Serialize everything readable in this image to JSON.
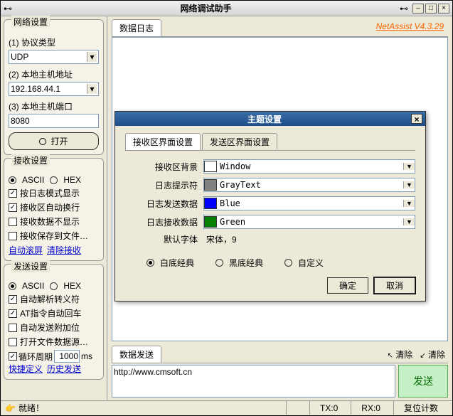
{
  "window": {
    "title": "网络调试助手"
  },
  "version": "NetAssist V4.3.29",
  "network": {
    "legend": "网络设置",
    "protocol_label": "(1) 协议类型",
    "protocol_value": "UDP",
    "host_label": "(2) 本地主机地址",
    "host_value": "192.168.44.1",
    "port_label": "(3) 本地主机端口",
    "port_value": "8080",
    "open_btn": "打开"
  },
  "recv": {
    "legend": "接收设置",
    "ascii": "ASCII",
    "hex": "HEX",
    "opt1": "按日志模式显示",
    "opt2": "接收区自动换行",
    "opt3": "接收数据不显示",
    "opt4": "接收保存到文件…",
    "link1": "自动滚屏",
    "link2": "清除接收"
  },
  "send": {
    "legend": "发送设置",
    "ascii": "ASCII",
    "hex": "HEX",
    "opt1": "自动解析转义符",
    "opt2": "AT指令自动回车",
    "opt3": "自动发送附加位",
    "opt4": "打开文件数据源…",
    "cycle_label": "循环周期",
    "cycle_value": "1000",
    "cycle_unit": "ms",
    "link1": "快捷定义",
    "link2": "历史发送"
  },
  "log_tab": "数据日志",
  "send_tab": "数据发送",
  "clear_btn1": "清除",
  "clear_btn2": "清除",
  "send_input": "http://www.cmsoft.cn",
  "send_btn": "发送",
  "status": {
    "ready": "就绪！",
    "tx": "TX:0",
    "rx": "RX:0",
    "reset": "复位计数"
  },
  "dialog": {
    "title": "主题设置",
    "tab1": "接收区界面设置",
    "tab2": "发送区界面设置",
    "row1_label": "接收区背景",
    "row1_value": "Window",
    "row1_color": "#ffffff",
    "row2_label": "日志提示符",
    "row2_value": "GrayText",
    "row2_color": "#808080",
    "row3_label": "日志发送数据",
    "row3_value": "Blue",
    "row3_color": "#0000ff",
    "row4_label": "日志接收数据",
    "row4_value": "Green",
    "row4_color": "#008000",
    "font_label": "默认字体",
    "font_value": "宋体，9",
    "theme1": "白底经典",
    "theme2": "黑底经典",
    "theme3": "自定义",
    "ok": "确定",
    "cancel": "取消"
  }
}
